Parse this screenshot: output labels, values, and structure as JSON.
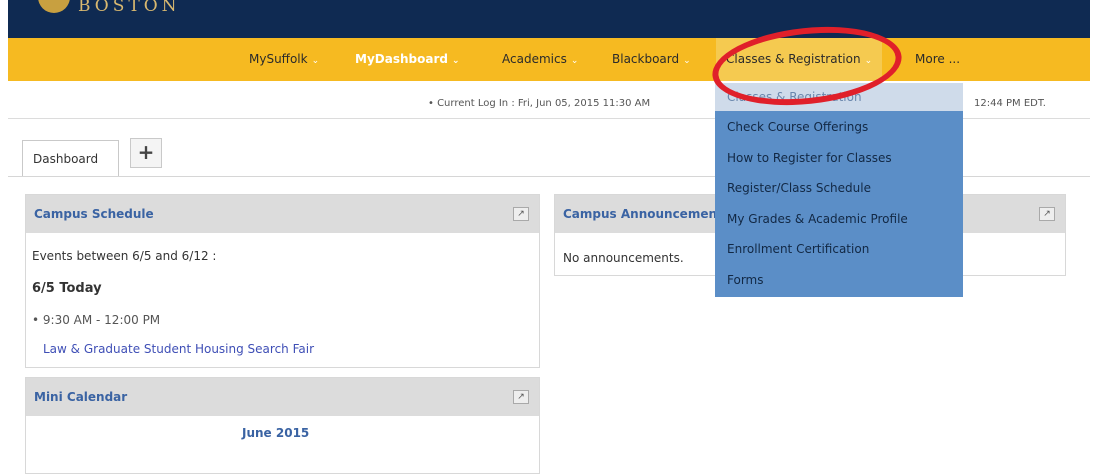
{
  "header": {
    "logo_text": "BOSTON"
  },
  "nav": {
    "items": [
      {
        "label": "MySuffolk",
        "chevron": "⌄"
      },
      {
        "label": "MyDashboard",
        "chevron": "⌄"
      },
      {
        "label": "Academics",
        "chevron": "⌄"
      },
      {
        "label": "Blackboard",
        "chevron": "⌄"
      },
      {
        "label": "Classes & Registration",
        "chevron": "⌄"
      },
      {
        "label": "More ...",
        "chevron": ""
      }
    ]
  },
  "status": {
    "current_login": "• Current Log In : Fri, Jun 05, 2015 11:30 AM",
    "last_login_time": "12:44 PM EDT."
  },
  "tabs": {
    "dashboard_label": "Dashboard",
    "add_label": "+"
  },
  "campus_schedule": {
    "title": "Campus Schedule",
    "range": "Events between 6/5 and 6/12 :",
    "day": "6/5 Today",
    "time": "• 9:30 AM - 12:00 PM",
    "event": "Law & Graduate Student Housing Search Fair"
  },
  "campus_announcements": {
    "title": "Campus Announcements",
    "body": "No announcements."
  },
  "mini_calendar": {
    "title": "Mini Calendar",
    "month": "June 2015"
  },
  "dropdown": {
    "items": [
      "Classes & Registration",
      "Check Course Offerings",
      "How to Register for Classes",
      "Register/Class Schedule",
      "My Grades & Academic Profile",
      "Enrollment Certification",
      "Forms"
    ]
  },
  "colors": {
    "topbar": "#0f2a52",
    "navbar": "#f6ba21",
    "dropdown": "#5b8ec7",
    "highlight_ring": "#e0202a",
    "panel_title": "#3a63a3"
  }
}
